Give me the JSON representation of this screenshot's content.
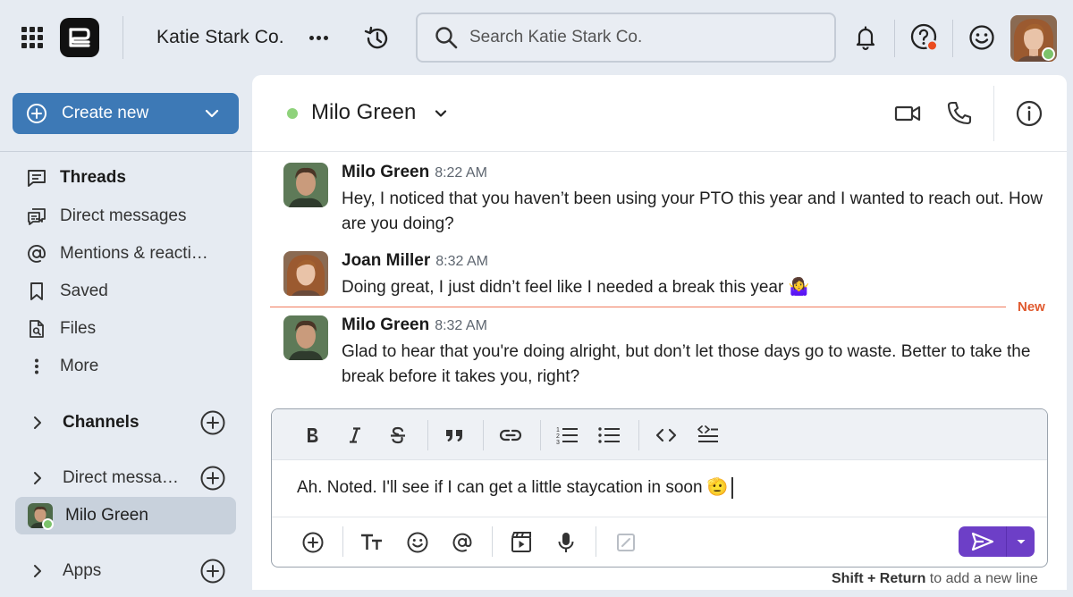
{
  "workspace": {
    "name": "Katie Stark Co."
  },
  "search": {
    "placeholder": "Search Katie Stark Co."
  },
  "sidebar": {
    "create_new_label": "Create new",
    "nav": [
      {
        "label": "Threads",
        "icon": "threads-icon"
      },
      {
        "label": "Direct messages",
        "icon": "direct-messages-icon"
      },
      {
        "label": "Mentions & reacti…",
        "icon": "at-icon"
      },
      {
        "label": "Saved",
        "icon": "bookmark-icon"
      },
      {
        "label": "Files",
        "icon": "file-search-icon"
      },
      {
        "label": "More",
        "icon": "more-vertical-icon"
      }
    ],
    "channels_label": "Channels",
    "direct_messages_label": "Direct messag…",
    "active_dm": {
      "name": "Milo Green"
    },
    "apps_label": "Apps"
  },
  "chat": {
    "title": "Milo Green",
    "new_label": "New",
    "messages": [
      {
        "author": "Milo Green",
        "time": "8:22 AM",
        "text": "Hey, I noticed that you haven’t been using your PTO this year and I wanted to reach out. How are you doing?"
      },
      {
        "author": "Joan Miller",
        "time": "8:32 AM",
        "text": "Doing great, I just didn’t feel like I needed a break this year 🤷‍♀️"
      },
      {
        "author": "Milo Green",
        "time": "8:32 AM",
        "text": "Glad to hear that you're doing alright, but don’t let those days go to waste. Better to take the break before it takes you, right?"
      }
    ]
  },
  "composer": {
    "draft": "Ah. Noted. I'll see if I can get a little staycation in soon 🫡",
    "hint_key": "Shift + Return",
    "hint_text": " to add a new line"
  },
  "colors": {
    "accent": "#3d79b6",
    "send": "#6d3fc7",
    "online": "#7cc36b",
    "new_divider": "#e05a2f"
  }
}
